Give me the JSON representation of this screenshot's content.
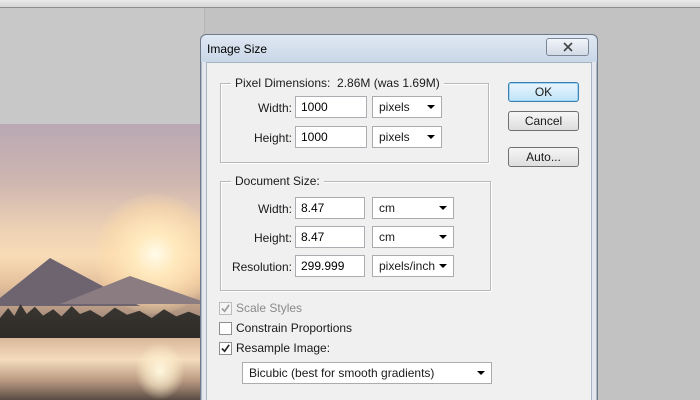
{
  "dialog": {
    "title": "Image Size",
    "close_icon": "close-x-icon"
  },
  "pixel_dimensions": {
    "label": "Pixel Dimensions:",
    "summary": "2.86M (was 1.69M)",
    "width_label": "Width:",
    "width_value": "1000",
    "width_unit": "pixels",
    "height_label": "Height:",
    "height_value": "1000",
    "height_unit": "pixels"
  },
  "document_size": {
    "label": "Document Size:",
    "width_label": "Width:",
    "width_value": "8.47",
    "width_unit": "cm",
    "height_label": "Height:",
    "height_value": "8.47",
    "height_unit": "cm",
    "resolution_label": "Resolution:",
    "resolution_value": "299.999",
    "resolution_unit": "pixels/inch"
  },
  "options": {
    "scale_styles": {
      "label": "Scale Styles",
      "checked": true,
      "enabled": false
    },
    "constrain_proportions": {
      "label": "Constrain Proportions",
      "checked": false,
      "enabled": true
    },
    "resample_image": {
      "label": "Resample Image:",
      "checked": true,
      "enabled": true
    },
    "resample_method": "Bicubic (best for smooth gradients)"
  },
  "buttons": {
    "ok": "OK",
    "cancel": "Cancel",
    "auto": "Auto..."
  },
  "colors": {
    "default_button_border": "#3c7fb1",
    "titlebar": "#cad7e7",
    "dialog_face": "#f0f0f0"
  }
}
